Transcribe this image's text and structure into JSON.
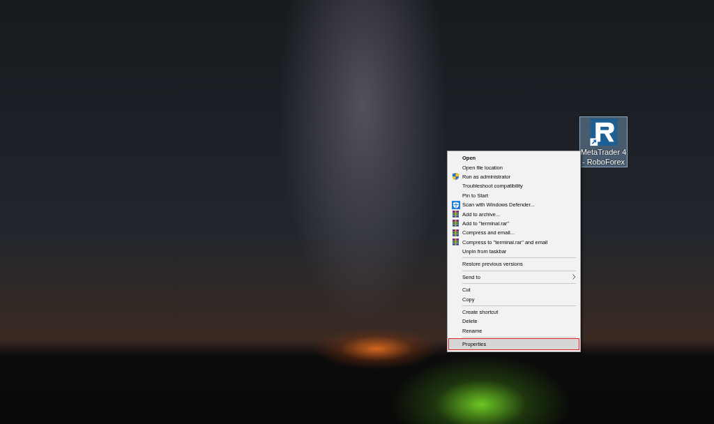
{
  "desktop_icon": {
    "label": "MetaTrader 4 - RoboForex",
    "selected": true
  },
  "context_menu": {
    "groups": [
      {
        "items": [
          {
            "label": "Open",
            "kind": "plain",
            "bold": true,
            "submenu": false,
            "selected": false
          },
          {
            "label": "Open file location",
            "kind": "plain",
            "bold": false,
            "submenu": false,
            "selected": false
          },
          {
            "label": "Run as administrator",
            "kind": "shield",
            "bold": false,
            "submenu": false,
            "selected": false
          },
          {
            "label": "Troubleshoot compatibility",
            "kind": "plain",
            "bold": false,
            "submenu": false,
            "selected": false
          },
          {
            "label": "Pin to Start",
            "kind": "plain",
            "bold": false,
            "submenu": false,
            "selected": false
          },
          {
            "label": "Scan with Windows Defender...",
            "kind": "defender",
            "bold": false,
            "submenu": false,
            "selected": false
          },
          {
            "label": "Add to archive...",
            "kind": "archive",
            "bold": false,
            "submenu": false,
            "selected": false
          },
          {
            "label": "Add to \"terminal.rar\"",
            "kind": "archive",
            "bold": false,
            "submenu": false,
            "selected": false
          },
          {
            "label": "Compress and email...",
            "kind": "archive",
            "bold": false,
            "submenu": false,
            "selected": false
          },
          {
            "label": "Compress to \"terminal.rar\" and email",
            "kind": "archive",
            "bold": false,
            "submenu": false,
            "selected": false
          },
          {
            "label": "Unpin from taskbar",
            "kind": "plain",
            "bold": false,
            "submenu": false,
            "selected": false
          }
        ]
      },
      {
        "items": [
          {
            "label": "Restore previous versions",
            "kind": "plain",
            "bold": false,
            "submenu": false,
            "selected": false
          }
        ]
      },
      {
        "items": [
          {
            "label": "Send to",
            "kind": "plain",
            "bold": false,
            "submenu": true,
            "selected": false
          }
        ]
      },
      {
        "items": [
          {
            "label": "Cut",
            "kind": "plain",
            "bold": false,
            "submenu": false,
            "selected": false
          },
          {
            "label": "Copy",
            "kind": "plain",
            "bold": false,
            "submenu": false,
            "selected": false
          }
        ]
      },
      {
        "items": [
          {
            "label": "Create shortcut",
            "kind": "plain",
            "bold": false,
            "submenu": false,
            "selected": false
          },
          {
            "label": "Delete",
            "kind": "plain",
            "bold": false,
            "submenu": false,
            "selected": false
          },
          {
            "label": "Rename",
            "kind": "plain",
            "bold": false,
            "submenu": false,
            "selected": false
          }
        ]
      },
      {
        "items": [
          {
            "label": "Properties",
            "kind": "plain",
            "bold": false,
            "submenu": false,
            "selected": true
          }
        ]
      }
    ]
  }
}
